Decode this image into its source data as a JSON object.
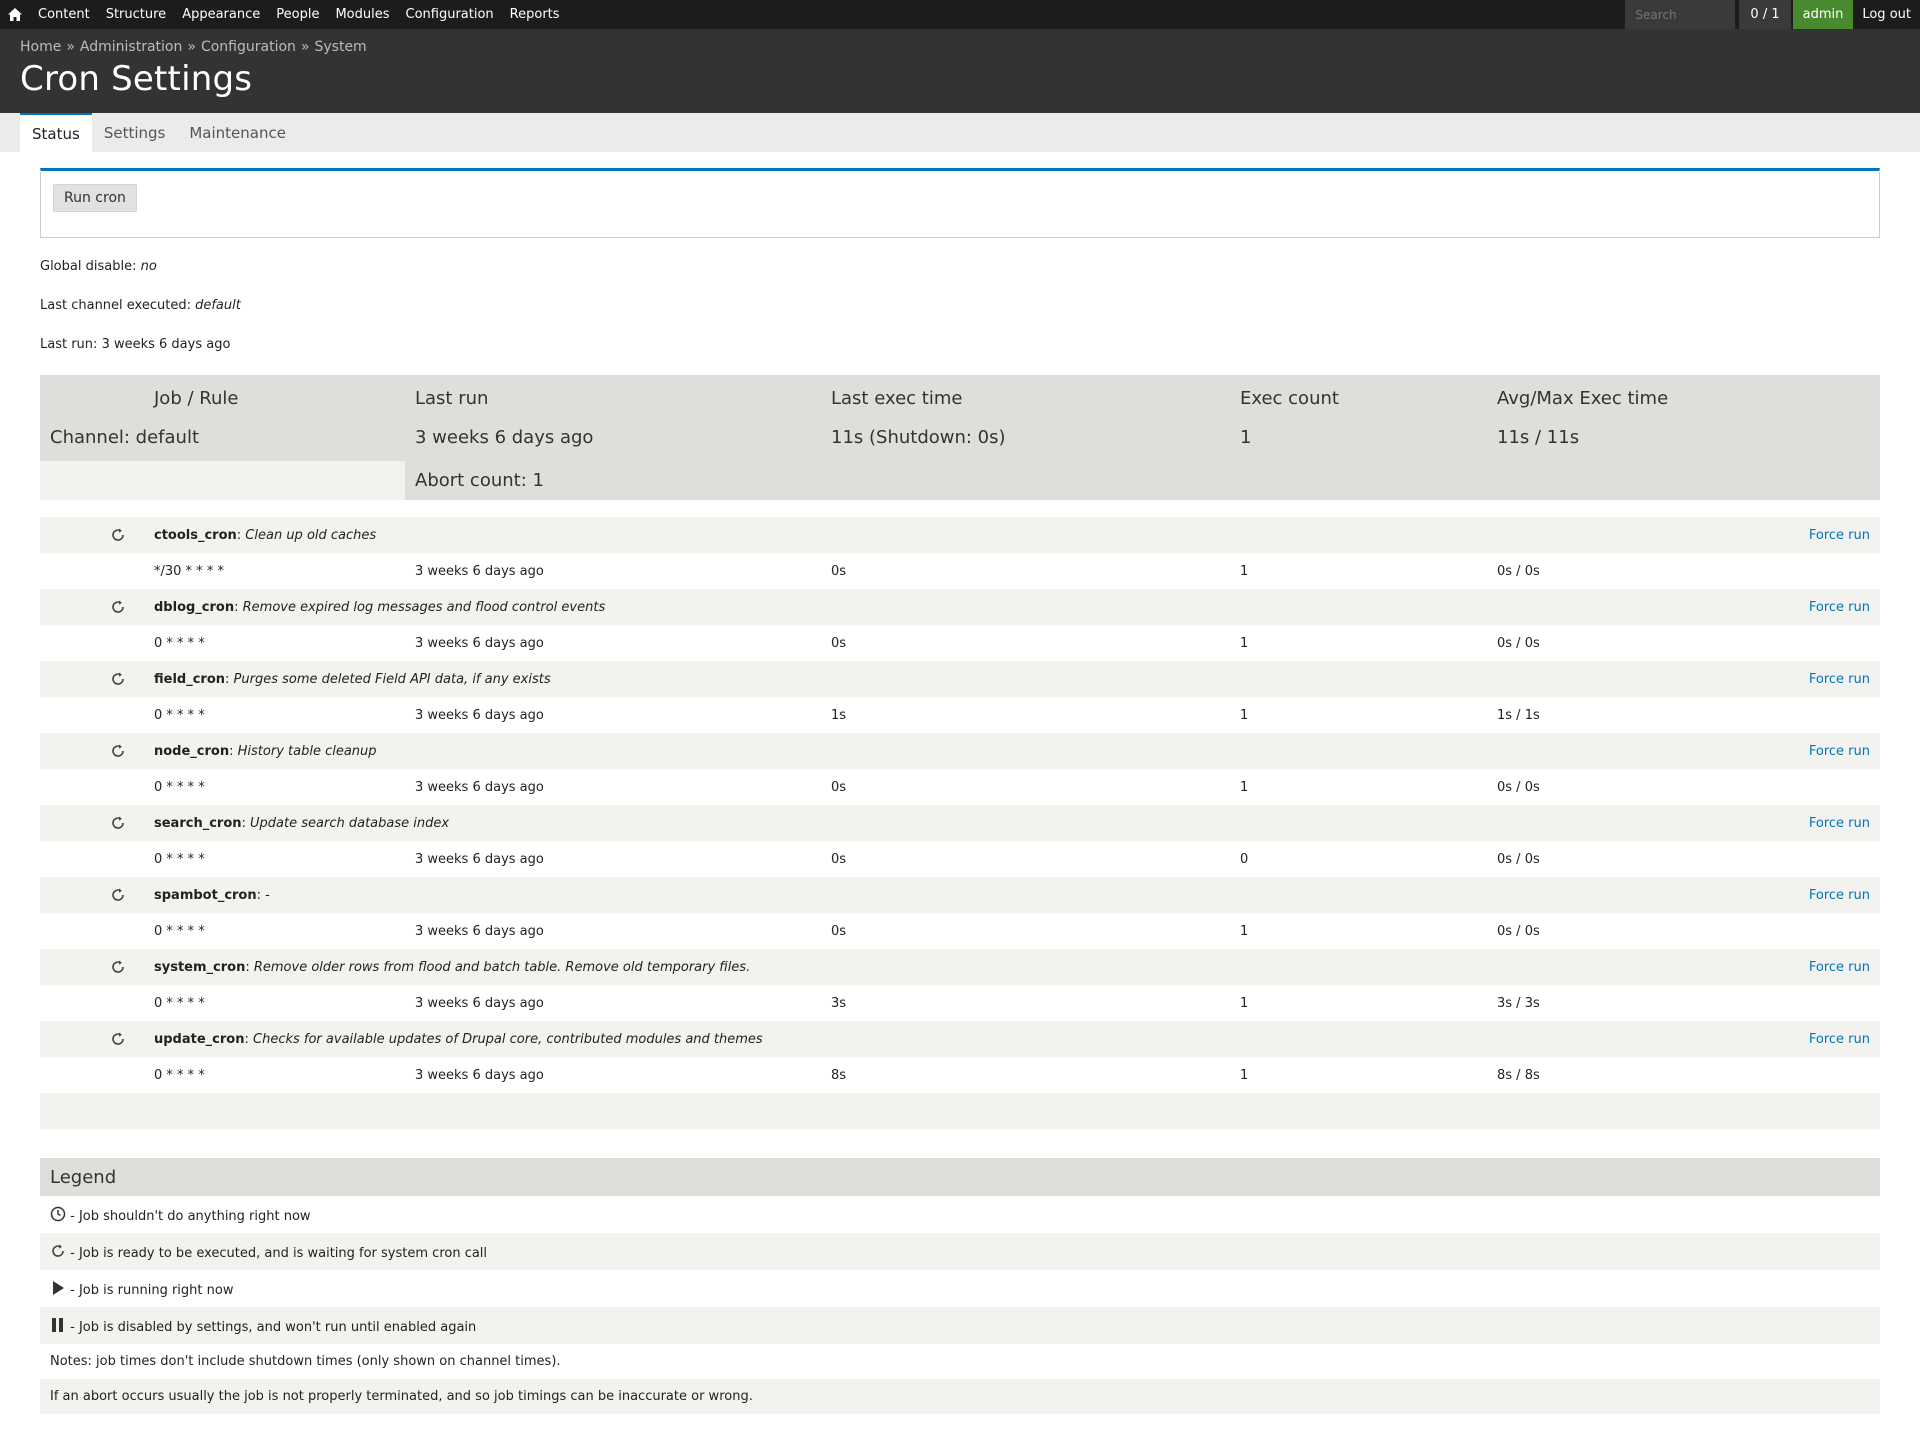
{
  "toolbar": {
    "home_icon": "home-icon",
    "menu": [
      "Content",
      "Structure",
      "Appearance",
      "People",
      "Modules",
      "Configuration",
      "Reports"
    ],
    "search_placeholder": "Search",
    "counter": "0 / 1",
    "user": "admin",
    "logout": "Log out"
  },
  "header": {
    "breadcrumb": [
      "Home",
      "Administration",
      "Configuration",
      "System"
    ],
    "separator": "»",
    "title": "Cron Settings"
  },
  "tabs": [
    "Status",
    "Settings",
    "Maintenance"
  ],
  "run_button": "Run cron",
  "info": {
    "global_disable_label": "Global disable:",
    "global_disable_value": "no",
    "last_channel_label": "Last channel executed:",
    "last_channel_value": "default",
    "last_run_label": "Last run:",
    "last_run_value": "3 weeks 6 days ago"
  },
  "table": {
    "headers": [
      "Job / Rule",
      "Last run",
      "Last exec time",
      "Exec count",
      "Avg/Max Exec time"
    ],
    "channel": {
      "label": "Channel: default",
      "last_run": "3 weeks 6 days ago",
      "exec_time": "11s (Shutdown: 0s)",
      "exec_count": "1",
      "avg_max": "11s / 11s",
      "abort": "Abort count: 1"
    },
    "force_run_label": "Force run",
    "jobs": [
      {
        "name": "ctools_cron",
        "desc": "Clean up old caches",
        "rule": "*/30 * * * *",
        "last_run": "3 weeks 6 days ago",
        "exec_time": "0s",
        "count": "1",
        "avg_max": "0s / 0s"
      },
      {
        "name": "dblog_cron",
        "desc": "Remove expired log messages and flood control events",
        "rule": "0 * * * *",
        "last_run": "3 weeks 6 days ago",
        "exec_time": "0s",
        "count": "1",
        "avg_max": "0s / 0s"
      },
      {
        "name": "field_cron",
        "desc": "Purges some deleted Field API data, if any exists",
        "rule": "0 * * * *",
        "last_run": "3 weeks 6 days ago",
        "exec_time": "1s",
        "count": "1",
        "avg_max": "1s / 1s"
      },
      {
        "name": "node_cron",
        "desc": "History table cleanup",
        "rule": "0 * * * *",
        "last_run": "3 weeks 6 days ago",
        "exec_time": "0s",
        "count": "1",
        "avg_max": "0s / 0s"
      },
      {
        "name": "search_cron",
        "desc": "Update search database index",
        "rule": "0 * * * *",
        "last_run": "3 weeks 6 days ago",
        "exec_time": "0s",
        "count": "0",
        "avg_max": "0s / 0s"
      },
      {
        "name": "spambot_cron",
        "desc": "-",
        "rule": "0 * * * *",
        "last_run": "3 weeks 6 days ago",
        "exec_time": "0s",
        "count": "1",
        "avg_max": "0s / 0s",
        "desc_plain": true
      },
      {
        "name": "system_cron",
        "desc": "Remove older rows from flood and batch table. Remove old temporary files.",
        "rule": "0 * * * *",
        "last_run": "3 weeks 6 days ago",
        "exec_time": "3s",
        "count": "1",
        "avg_max": "3s / 3s"
      },
      {
        "name": "update_cron",
        "desc": "Checks for available updates of Drupal core, contributed modules and themes",
        "rule": "0 * * * *",
        "last_run": "3 weeks 6 days ago",
        "exec_time": "8s",
        "count": "1",
        "avg_max": "8s / 8s"
      }
    ]
  },
  "legend": {
    "title": "Legend",
    "items": [
      {
        "icon": "clock-icon",
        "text": "- Job shouldn't do anything right now"
      },
      {
        "icon": "refresh-icon",
        "text": "- Job is ready to be executed, and is waiting for system cron call"
      },
      {
        "icon": "play-icon",
        "text": "- Job is running right now"
      },
      {
        "icon": "pause-icon",
        "text": "- Job is disabled by settings, and won't run until enabled again"
      }
    ],
    "notes": [
      "Notes: job times don't include shutdown times (only shown on channel times).",
      "If an abort occurs usually the job is not properly terminated, and so job timings can be inaccurate or wrong."
    ]
  },
  "colors": {
    "accent": "#0074bd",
    "toolbar_bg": "#1c1c1c",
    "header_bg": "#333333",
    "user_badge": "#4a8a2e"
  }
}
